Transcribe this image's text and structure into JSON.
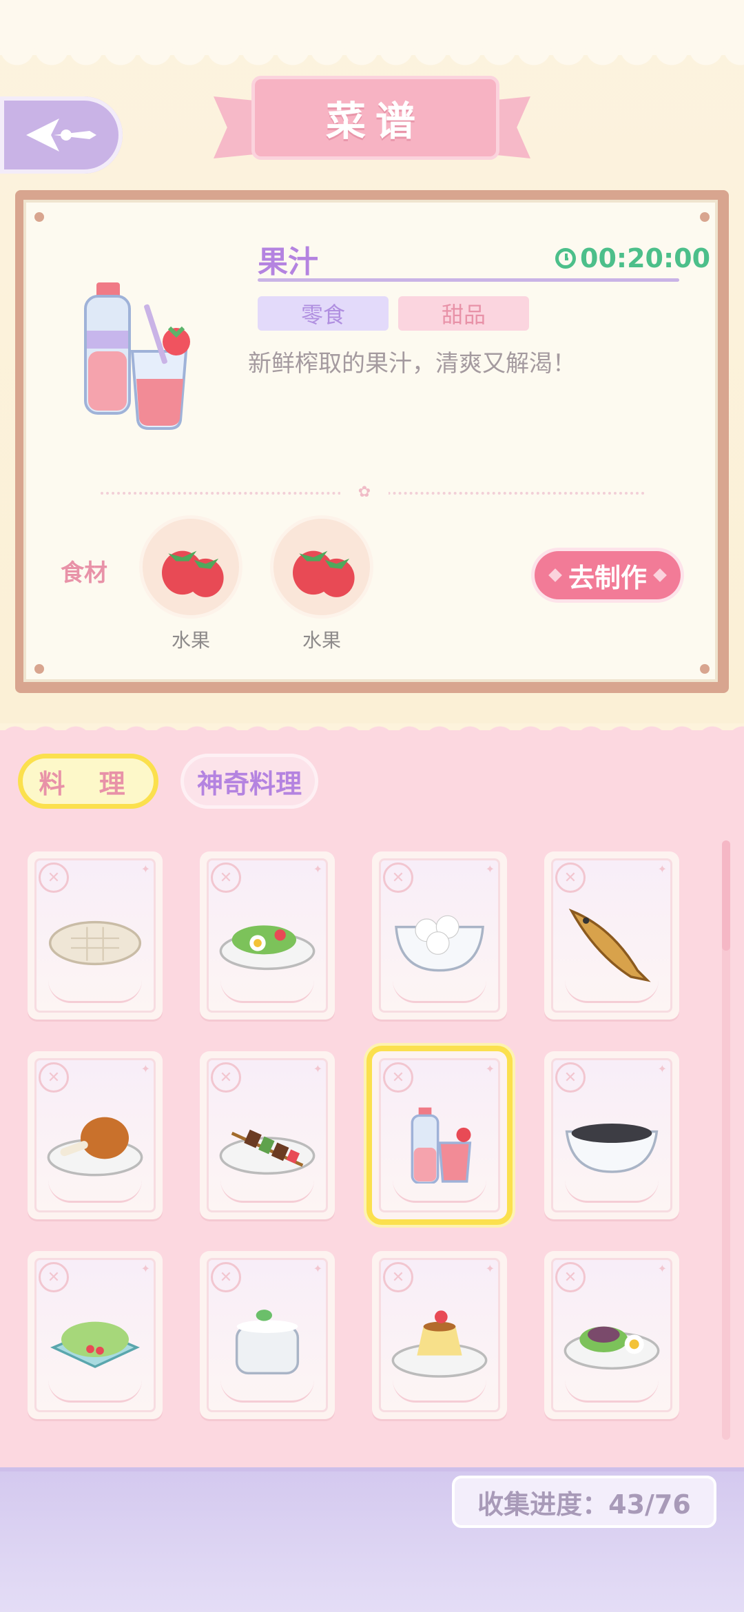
{
  "header": {
    "title": "菜谱"
  },
  "recipe": {
    "name": "果汁",
    "timer": "00:20:00",
    "tags": [
      "零食",
      "甜品"
    ],
    "description": "新鲜榨取的果汁，清爽又解渴！",
    "ingredients_label": "食材",
    "ingredients": [
      {
        "name": "水果",
        "icon": "strawberry-icon"
      },
      {
        "name": "水果",
        "icon": "strawberry-icon"
      }
    ],
    "make_button": "去制作"
  },
  "tabs": [
    {
      "label": "料 理",
      "active": true
    },
    {
      "label": "神奇料理",
      "active": false
    }
  ],
  "dishes": [
    {
      "icon": "flatbread-icon",
      "selected": false
    },
    {
      "icon": "salad-icon",
      "selected": false
    },
    {
      "icon": "dumplings-bowl-icon",
      "selected": false
    },
    {
      "icon": "fish-icon",
      "selected": false
    },
    {
      "icon": "chicken-leg-icon",
      "selected": false
    },
    {
      "icon": "skewer-icon",
      "selected": false
    },
    {
      "icon": "juice-icon",
      "selected": true
    },
    {
      "icon": "black-soup-icon",
      "selected": false
    },
    {
      "icon": "lettuce-plate-icon",
      "selected": false
    },
    {
      "icon": "yogurt-jar-icon",
      "selected": false
    },
    {
      "icon": "pudding-icon",
      "selected": false
    },
    {
      "icon": "meat-salad-icon",
      "selected": false
    }
  ],
  "collection": {
    "label": "收集进度：43/76"
  },
  "colors": {
    "accent_purple": "#b483e0",
    "accent_pink": "#f27b97",
    "timer_green": "#4cbf8a",
    "selected_yellow": "#fbe04d"
  }
}
